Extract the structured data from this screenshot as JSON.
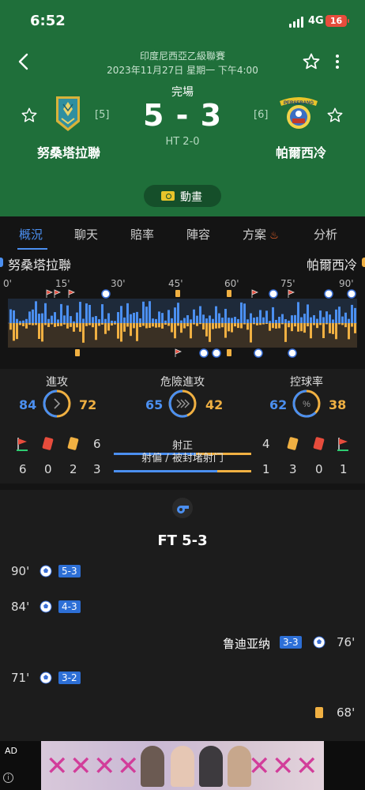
{
  "status_bar": {
    "time": "6:52",
    "network": "4G",
    "battery": "16"
  },
  "header": {
    "league": "印度尼西亞乙級聯賽",
    "datetime": "2023年11月27日 星期一 下午4:00",
    "status": "完場",
    "score": "5 - 3",
    "half_time": "HT 2-0",
    "home": {
      "name": "努桑塔拉聯",
      "rank": "[5]"
    },
    "away": {
      "name": "帕爾西冷",
      "rank": "[6]",
      "logo_text": "PERSERANG"
    },
    "animation_label": "動畫",
    "icons": [
      "back-arrow-icon",
      "star-icon",
      "more-vertical-icon"
    ]
  },
  "tabs": [
    {
      "label": "概況",
      "active": true
    },
    {
      "label": "聊天"
    },
    {
      "label": "賠率"
    },
    {
      "label": "陣容"
    },
    {
      "label": "方案",
      "icon": "fire-icon"
    },
    {
      "label": "分析"
    }
  ],
  "momentum": {
    "home_team": "努桑塔拉聯",
    "away_team": "帕爾西冷",
    "ticks": [
      "0'",
      "15'",
      "30'",
      "45'",
      "60'",
      "75'",
      "90'"
    ],
    "home_color": "#4b8ff0",
    "away_color": "#f0b042"
  },
  "stats": {
    "attack": {
      "label": "進攻",
      "home": "84",
      "away": "72"
    },
    "dangerous_attack": {
      "label": "危險進攻",
      "home": "65",
      "away": "42"
    },
    "possession": {
      "label": "控球率",
      "home": "62",
      "away": "38",
      "icon": "%"
    },
    "shots_on_target": {
      "label": "射正",
      "home": "6",
      "away": "4"
    },
    "shots_off_blocked": {
      "label": "射偏 / 被封堵射门",
      "home": "3",
      "away": "1"
    },
    "home_cards": {
      "corners": "6",
      "red": "0",
      "yellow": "2"
    },
    "away_cards": {
      "yellow": "3",
      "red": "0",
      "corners": "1"
    }
  },
  "events": {
    "final": "FT 5-3",
    "items": [
      {
        "minute": "90'",
        "side": "home",
        "type": "goal",
        "score": "5-3"
      },
      {
        "minute": "84'",
        "side": "home",
        "type": "goal",
        "score": "4-3"
      },
      {
        "minute": "76'",
        "side": "away",
        "type": "goal",
        "score": "3-3",
        "player": "鲁迪亚纳"
      },
      {
        "minute": "71'",
        "side": "home",
        "type": "goal",
        "score": "3-2"
      },
      {
        "minute": "68'",
        "side": "away",
        "type": "yellow-card"
      }
    ]
  },
  "ad": {
    "label": "AD",
    "info": "i"
  }
}
